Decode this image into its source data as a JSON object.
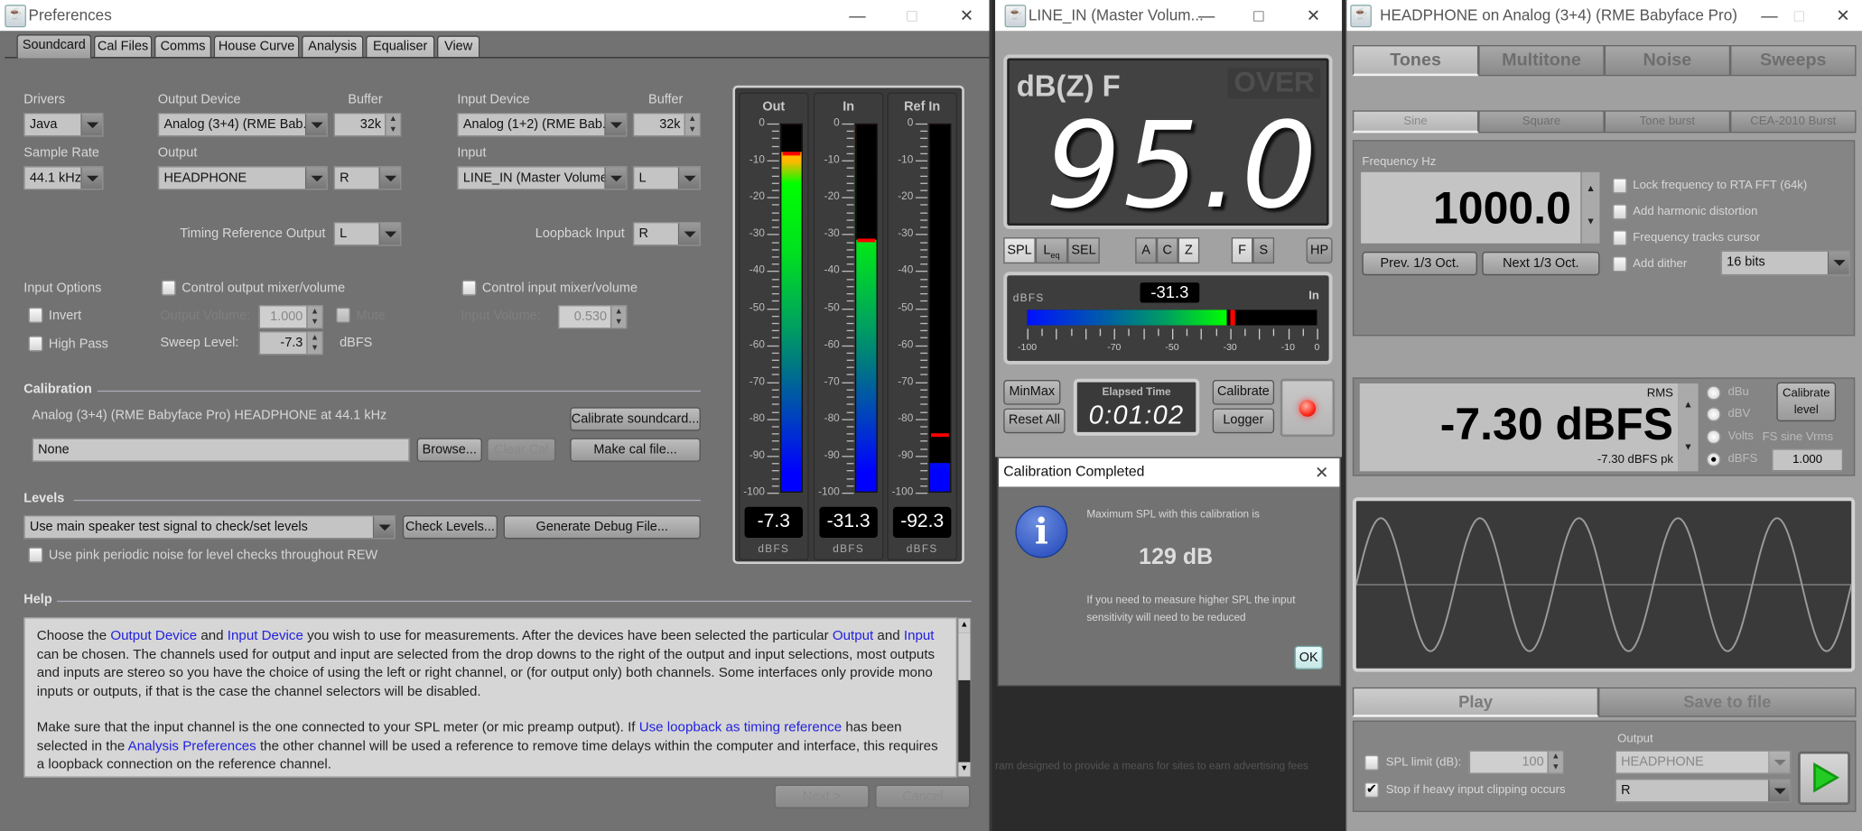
{
  "preferences": {
    "title": "Preferences",
    "tabs": [
      "Soundcard",
      "Cal Files",
      "Comms",
      "House Curve",
      "Analysis",
      "Equaliser",
      "View"
    ],
    "active_tab": "Soundcard",
    "drivers": {
      "label": "Drivers",
      "value": "Java"
    },
    "sample_rate": {
      "label": "Sample Rate",
      "value": "44.1 kHz"
    },
    "output_device": {
      "label": "Output Device",
      "value": "Analog (3+4) (RME Bab..."
    },
    "output_buffer": {
      "label": "Buffer",
      "value": "32k"
    },
    "input_device": {
      "label": "Input Device",
      "value": "Analog (1+2) (RME Bab..."
    },
    "input_buffer": {
      "label": "Buffer",
      "value": "32k"
    },
    "output": {
      "label": "Output",
      "value": "HEADPHONE",
      "channel": "R"
    },
    "input": {
      "label": "Input",
      "value": "LINE_IN (Master Volume)",
      "channel": "L"
    },
    "timing_ref_output": {
      "label": "Timing Reference Output",
      "value": "L"
    },
    "loopback_input": {
      "label": "Loopback Input",
      "value": "R"
    },
    "input_options": {
      "label": "Input Options",
      "invert": {
        "label": "Invert",
        "checked": false
      },
      "high_pass": {
        "label": "High Pass",
        "checked": false
      }
    },
    "control_output_mixer": {
      "label": "Control output mixer/volume",
      "checked": false
    },
    "output_volume": {
      "label": "Output Volume:",
      "value": "1.000"
    },
    "mute": {
      "label": "Mute",
      "checked": false
    },
    "sweep_level": {
      "label": "Sweep Level:",
      "value": "-7.3",
      "unit": "dBFS"
    },
    "control_input_mixer": {
      "label": "Control input mixer/volume",
      "checked": false
    },
    "input_volume": {
      "label": "Input Volume:",
      "value": "0.530"
    },
    "calibration": {
      "header": "Calibration",
      "description": "Analog (3+4) (RME Babyface Pro) HEADPHONE at 44.1 kHz",
      "calibrate_button": "Calibrate soundcard...",
      "file_value": "None",
      "browse_button": "Browse...",
      "clear_button": "Clear Cal",
      "make_button": "Make cal file..."
    },
    "levels": {
      "header": "Levels",
      "method": "Use main speaker test signal to check/set levels",
      "check_button": "Check Levels...",
      "debug_button": "Generate Debug File...",
      "pink_noise": {
        "label": "Use pink periodic noise for level checks throughout REW",
        "checked": false
      }
    },
    "help": {
      "header": "Help",
      "paragraphs": [
        [
          {
            "t": "Choose the "
          },
          {
            "t": "Output Device",
            "link": true
          },
          {
            "t": " and "
          },
          {
            "t": "Input Device",
            "link": true
          },
          {
            "t": " you wish to use for measurements. After the devices have been selected the particular "
          },
          {
            "t": "Output",
            "link": true
          },
          {
            "t": " and "
          },
          {
            "t": "Input",
            "link": true
          },
          {
            "t": " can be chosen. The channels used for output and input are selected from the drop downs to the right of the output and input selections, most outputs and inputs are stereo so you have the choice of using the left or right channel, or (for output only) both channels. Some interfaces only provide mono inputs or outputs, if that is the case the channel selectors will be disabled."
          }
        ],
        [
          {
            "t": "Make sure that the input channel is the one connected to your SPL meter (or mic preamp output). If "
          },
          {
            "t": "Use loopback as timing reference",
            "link": true
          },
          {
            "t": " has been selected in the "
          },
          {
            "t": "Analysis Preferences",
            "link": true
          },
          {
            "t": " the other channel will be used a reference to remove time delays within the computer and interface, this requires a loopback connection on the reference channel."
          }
        ]
      ]
    },
    "next_button": "Next >",
    "cancel_button": "Cancel",
    "meters": {
      "scale_labels": [
        "0",
        "-10",
        "-20",
        "-30",
        "-40",
        "-50",
        "-60",
        "-70",
        "-80",
        "-90",
        "-100"
      ],
      "unit": "dBFS",
      "channels": [
        {
          "name": "Out",
          "value": "-7.3",
          "level_db": -7.3,
          "peak_db": -7.5
        },
        {
          "name": "In",
          "value": "-31.3",
          "level_db": -31.3,
          "peak_db": -31.0
        },
        {
          "name": "Ref In",
          "value": "-92.3",
          "level_db": -92.3,
          "peak_db": -84.0
        }
      ]
    }
  },
  "spl_meter": {
    "title": "LINE_IN (Master Volum...",
    "mode": "dB(Z) F",
    "over": "OVER",
    "reading": "95.0",
    "buttons": {
      "spl": "SPL",
      "leq": "L",
      "leq_sub": "eq",
      "sel": "SEL",
      "a": "A",
      "c": "C",
      "z": "Z",
      "f": "F",
      "s": "S",
      "hp": "HP"
    },
    "active": {
      "metric": "spl",
      "weighting": "z",
      "time": "f"
    },
    "input_meter": {
      "unit": "dBFS",
      "value": "-31.3",
      "level_db": -31.3,
      "peak_db": -30,
      "channel": "In",
      "scale_labels": [
        "-100",
        "-70",
        "-50",
        "-30",
        "-10",
        "0"
      ]
    },
    "minmax": "MinMax",
    "reset_all": "Reset All",
    "elapsed_label": "Elapsed Time",
    "elapsed": "0:01:02",
    "calibrate": "Calibrate",
    "logger": "Logger",
    "record_color": "#ff2a1a"
  },
  "dialog": {
    "title": "Calibration Completed",
    "icon": "info-icon",
    "line1": "Maximum SPL with this calibration is",
    "value": "129 dB",
    "line2": "If you need to measure higher SPL the input sensitivity will need to be reduced",
    "ok": "OK"
  },
  "background_text": "ram designed to provide a means for sites to earn advertising fees",
  "generator": {
    "title": "HEADPHONE on Analog (3+4) (RME Babyface Pro)",
    "tabs": [
      "Tones",
      "Multitone",
      "Noise",
      "Sweeps"
    ],
    "active_tab": "Tones",
    "subtabs": [
      "Sine",
      "Square",
      "Tone burst",
      "CEA-2010 Burst"
    ],
    "active_subtab": "Sine",
    "frequency_label": "Frequency Hz",
    "frequency": "1000.0",
    "prev_button": "Prev. 1/3 Oct.",
    "next_button": "Next 1/3 Oct.",
    "options": [
      {
        "label": "Lock frequency to RTA FFT (64k)",
        "checked": false
      },
      {
        "label": "Add harmonic distortion",
        "checked": false
      },
      {
        "label": "Frequency tracks cursor",
        "checked": false
      },
      {
        "label": "Add dither",
        "checked": false
      }
    ],
    "dither_bits": "16 bits",
    "level_mode": "RMS",
    "level": "-7.30 dBFS",
    "level_peak": "-7.30 dBFS pk",
    "units": [
      {
        "label": "dBu",
        "selected": false
      },
      {
        "label": "dBV",
        "selected": false
      },
      {
        "label": "Volts",
        "selected": false
      },
      {
        "label": "dBFS",
        "selected": true
      }
    ],
    "calibrate_level": [
      "Calibrate",
      "level"
    ],
    "fs_sine_label": "FS sine Vrms",
    "fs_sine_value": "1.000",
    "actions": [
      "Play",
      "Save to file"
    ],
    "active_action": "Play",
    "spl_limit": {
      "label": "SPL limit (dB):",
      "value": "100",
      "checked": false
    },
    "stop_clipping": {
      "label": "Stop if heavy input clipping occurs",
      "checked": true
    },
    "output_label": "Output",
    "output_device": "HEADPHONE",
    "output_channel": "R",
    "play_color": "#22cc22"
  },
  "colors": {
    "link": "#2222dd",
    "panel": "#737373",
    "meter_bg": "#3c3c3c",
    "peak": "#ff0000"
  }
}
